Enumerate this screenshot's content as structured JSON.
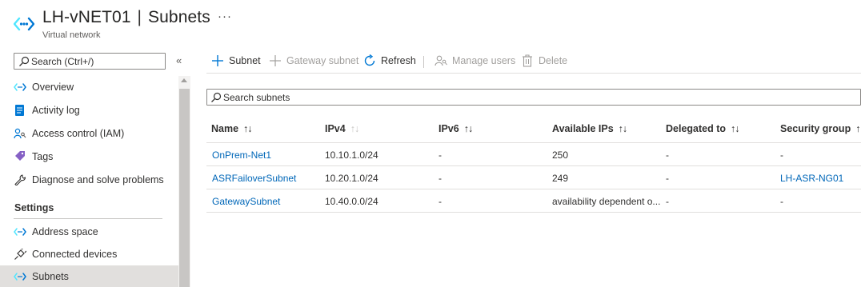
{
  "header": {
    "resource_name": "LH-vNET01",
    "separator": "|",
    "page_name": "Subnets",
    "subtitle": "Virtual network",
    "more": "···"
  },
  "sidebar": {
    "search_placeholder": "Search (Ctrl+/)",
    "collapse_glyph": "«",
    "items": [
      {
        "label": "Overview",
        "icon": "vnet-icon"
      },
      {
        "label": "Activity log",
        "icon": "activity-log-icon"
      },
      {
        "label": "Access control (IAM)",
        "icon": "iam-icon"
      },
      {
        "label": "Tags",
        "icon": "tag-icon"
      },
      {
        "label": "Diagnose and solve problems",
        "icon": "wrench-icon"
      }
    ],
    "section_heading": "Settings",
    "settings_items": [
      {
        "label": "Address space",
        "icon": "vnet-icon"
      },
      {
        "label": "Connected devices",
        "icon": "plug-icon"
      },
      {
        "label": "Subnets",
        "icon": "vnet-icon",
        "active": true
      }
    ]
  },
  "toolbar": {
    "subnet": "Subnet",
    "gateway_subnet": "Gateway subnet",
    "refresh": "Refresh",
    "manage_users": "Manage users",
    "delete": "Delete"
  },
  "grid_search": {
    "placeholder": "Search subnets"
  },
  "table": {
    "columns": [
      "Name",
      "IPv4",
      "IPv6",
      "Available IPs",
      "Delegated to",
      "Security group"
    ],
    "sort_glyph": "↑↓",
    "sort_glyph_ipv4": "↑↓",
    "rows": [
      {
        "name": "OnPrem-Net1",
        "ipv4": "10.10.1.0/24",
        "ipv6": "-",
        "available": "250",
        "delegated": "-",
        "nsg": "-"
      },
      {
        "name": "ASRFailoverSubnet",
        "ipv4": "10.20.1.0/24",
        "ipv6": "-",
        "available": "249",
        "delegated": "-",
        "nsg": "LH-ASR-NG01"
      },
      {
        "name": "GatewaySubnet",
        "ipv4": "10.40.0.0/24",
        "ipv6": "-",
        "available": "availability dependent o...",
        "delegated": "-",
        "nsg": "-"
      }
    ]
  },
  "colors": {
    "link": "#0067b8",
    "accent": "#0078d4",
    "active_nav": "#e1dfdd"
  }
}
